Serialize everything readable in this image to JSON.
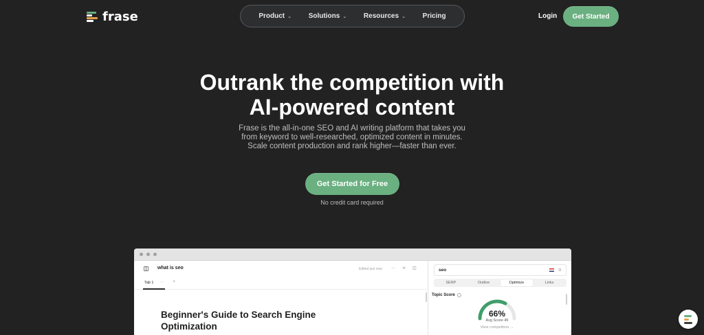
{
  "header": {
    "logo_text": "frase",
    "nav": [
      {
        "label": "Product",
        "has_dropdown": true
      },
      {
        "label": "Solutions",
        "has_dropdown": true
      },
      {
        "label": "Resources",
        "has_dropdown": true
      },
      {
        "label": "Pricing",
        "has_dropdown": false
      }
    ],
    "login_label": "Login",
    "cta_label": "Get Started"
  },
  "hero": {
    "title_line1": "Outrank the competition with",
    "title_line2": "AI-powered content",
    "subtitle_line1": "Frase is the all-in-one SEO and AI writing platform that takes you",
    "subtitle_line2": "from keyword to well-researched, optimized content in minutes.",
    "subtitle_line3": "Scale content production and rank higher—faster than ever.",
    "cta_label": "Get Started for Free",
    "note": "No credit card required"
  },
  "preview": {
    "doc_name": "what is seo",
    "edited_status": "Edited just now",
    "tab_label": "Tab 1",
    "tab_more": "···",
    "tab_add": "+",
    "doc_title_line1": "Beginner's Guide to Search Engine",
    "doc_title_line2": "Optimization",
    "search_value": "seo",
    "segments": [
      "SERP",
      "Outline",
      "Optimize",
      "Links"
    ],
    "active_segment": "Optimize",
    "topic_score_label": "Topic Score",
    "score_percent": "66%",
    "score_value": 0.66,
    "avg_score": "Avg Score 45",
    "view_competitors": "View competitors →"
  },
  "colors": {
    "background": "#222222",
    "accent_green": "#6ab080",
    "gauge_green": "#3f9e6a"
  },
  "icons": {
    "logo": "frase-logo-icon",
    "sidebar_toggle": "sidebar-toggle-icon",
    "share": "share-icon",
    "panel": "panel-icon",
    "flag": "us-flag-icon",
    "settings": "settings-icon",
    "info": "info-icon",
    "chat": "chat-widget-icon"
  }
}
